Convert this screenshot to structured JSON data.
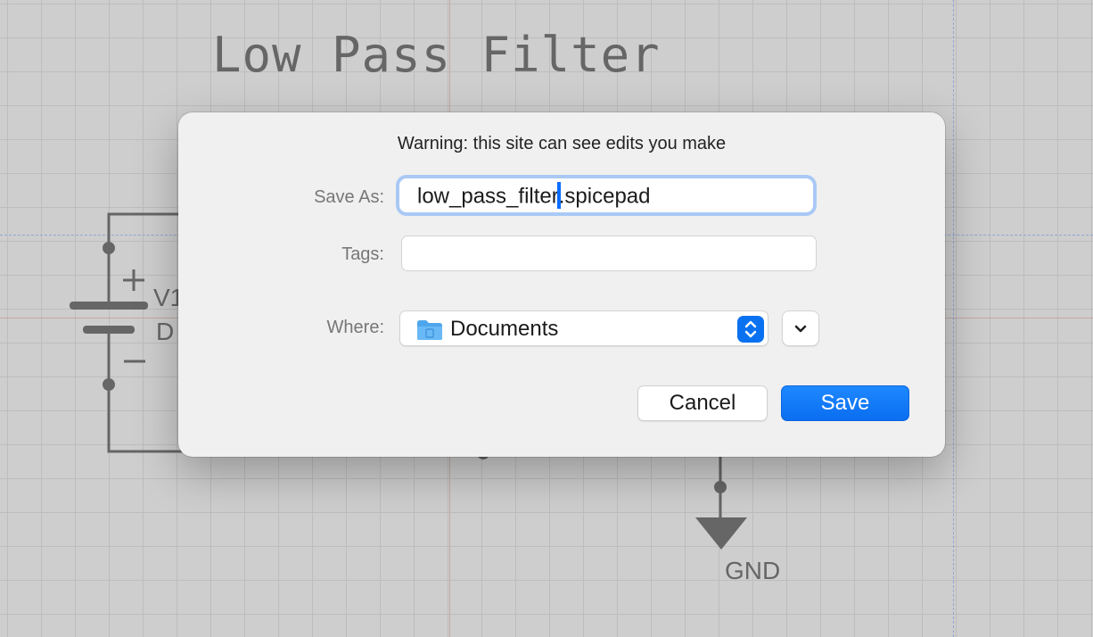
{
  "schematic": {
    "title": "Low Pass Filter",
    "labels": {
      "gnd": "GND",
      "v1": "V1",
      "d": "D",
      "plus": "+",
      "minus": "−"
    }
  },
  "dialog": {
    "warning": "Warning: this site can see edits you make",
    "save_as_label": "Save As:",
    "filename_before_caret": "low_pass_filter",
    "filename_after_caret": ".spicepad",
    "tags_label": "Tags:",
    "tags_value": "",
    "where_label": "Where:",
    "where_value": "Documents",
    "cancel_label": "Cancel",
    "save_label": "Save"
  },
  "colors": {
    "accent": "#0a72f0",
    "caret": "#0a6cff",
    "wire": "#666666"
  },
  "icons": {
    "folder": "folder-icon",
    "stepper": "up-down-chevron-icon",
    "expand": "chevron-down-icon"
  }
}
